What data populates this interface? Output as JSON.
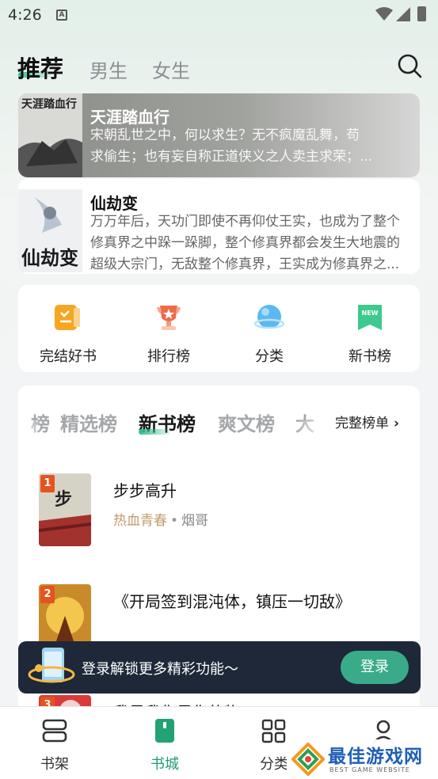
{
  "status_bar": {
    "time": "4:26",
    "notification_letter": "A"
  },
  "top_tabs": [
    {
      "label": "推荐",
      "active": true
    },
    {
      "label": "男生",
      "active": false
    },
    {
      "label": "女生",
      "active": false
    }
  ],
  "featured_books": [
    {
      "title": "天涯踏血行",
      "desc_line1": "宋朝乱世之中，何以求生？无不疯魔乱舞，苟",
      "desc_line2": "求偷生；也有妄自称正道侠义之人卖主求荣；...",
      "cover_text": "天涯踏血行"
    },
    {
      "title": "仙劫变",
      "desc_line1": "万万年后，天功门即使不再仰仗王实，也成为了整个",
      "desc_line2": "修真界之中跺一跺脚，整个修真界都会发生大地震的",
      "desc_line3": "超级大宗门，无敌整个修真界，王实成为修真界之...",
      "cover_text": "仙劫变"
    }
  ],
  "quick_links": [
    {
      "label": "完结好书",
      "icon": "book-complete-icon"
    },
    {
      "label": "排行榜",
      "icon": "trophy-icon"
    },
    {
      "label": "分类",
      "icon": "planet-icon"
    },
    {
      "label": "新书榜",
      "icon": "new-book-icon"
    }
  ],
  "ranking": {
    "tabs": [
      {
        "label": "榜",
        "active": false
      },
      {
        "label": "精选榜",
        "active": false
      },
      {
        "label": "新书榜",
        "active": true
      },
      {
        "label": "爽文榜",
        "active": false
      },
      {
        "label": "大",
        "active": false
      }
    ],
    "full_list_label": "完整榜单",
    "items": [
      {
        "rank": "1",
        "title": "步步高升",
        "genre": "热血青春",
        "author": "烟哥"
      },
      {
        "rank": "2",
        "title": "《开局签到混沌体，镇压一切敌》",
        "genre": "",
        "author": ""
      },
      {
        "rank": "3",
        "title": "我是我你是你的物",
        "genre": "",
        "author": ""
      }
    ]
  },
  "login_bar": {
    "text": "登录解锁更多精彩功能～",
    "button": "登录"
  },
  "bottom_nav": [
    {
      "label": "书架",
      "icon": "bookshelf-icon",
      "active": false
    },
    {
      "label": "书城",
      "icon": "bookstore-icon",
      "active": true
    },
    {
      "label": "分类",
      "icon": "category-grid-icon",
      "active": false
    },
    {
      "label": "我的",
      "icon": "profile-icon",
      "active": false
    }
  ],
  "watermark": {
    "title": "最佳游戏网",
    "subtitle": "BEST GAME WEBSITE"
  },
  "colors": {
    "accent": "#2fbf8f",
    "login_bg": "#1e2838",
    "login_btn": "#3aab88",
    "genre": "#c29a6b"
  }
}
